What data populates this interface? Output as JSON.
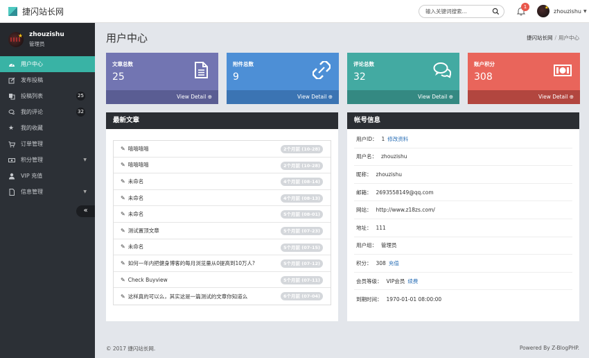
{
  "brand": {
    "name": "捷闪站长网"
  },
  "search": {
    "placeholder": "输入关键词搜索..."
  },
  "notifications": {
    "count": "1"
  },
  "user": {
    "name": "zhouzishu",
    "role": "管理员"
  },
  "sidebar": {
    "items": [
      {
        "label": "用户中心",
        "icon": "dashboard-icon",
        "active": true
      },
      {
        "label": "发布投稿",
        "icon": "edit-icon"
      },
      {
        "label": "投稿列表",
        "icon": "copy-icon",
        "badge": "25"
      },
      {
        "label": "我的评论",
        "icon": "comments-icon",
        "badge": "32"
      },
      {
        "label": "我的收藏",
        "icon": "star-icon"
      },
      {
        "label": "订单管理",
        "icon": "cart-icon"
      },
      {
        "label": "积分管理",
        "icon": "money-icon",
        "caret": true
      },
      {
        "label": "VIP 充值",
        "icon": "user-icon"
      },
      {
        "label": "信息管理",
        "icon": "file-icon",
        "caret": true
      }
    ],
    "collapse_label": "«"
  },
  "page": {
    "title": "用户中心",
    "breadcrumb": [
      "捷闪站长网",
      "/",
      "用户中心"
    ]
  },
  "stats": [
    {
      "label": "文章总数",
      "value": "25",
      "footer": "View Detail ⊕",
      "color": "#7275b2",
      "foot_color": "#5a5d93",
      "icon": "file-text-icon"
    },
    {
      "label": "附件总数",
      "value": "9",
      "footer": "View Detail ⊕",
      "color": "#4d8fd6",
      "foot_color": "#3b74b3",
      "icon": "broken-link-icon"
    },
    {
      "label": "评论总数",
      "value": "32",
      "footer": "View Detail ⊕",
      "color": "#43aaa2",
      "foot_color": "#348982",
      "icon": "comments-icon"
    },
    {
      "label": "账户积分",
      "value": "308",
      "footer": "View Detail ⊕",
      "color": "#e9655b",
      "foot_color": "#b2463f",
      "icon": "money-bill-icon"
    }
  ],
  "latest": {
    "title": "最新文章",
    "articles": [
      {
        "title": "嘻嘻嘻嘻",
        "date": "2个月前 (10-28)"
      },
      {
        "title": "嘻嘻嘻嘻",
        "date": "2个月前 (10-28)"
      },
      {
        "title": "未命名",
        "date": "4个月前 (08-14)"
      },
      {
        "title": "未命名",
        "date": "4个月前 (08-13)"
      },
      {
        "title": "未命名",
        "date": "5个月前 (08-01)"
      },
      {
        "title": "测试置顶文章",
        "date": "5个月前 (07-23)"
      },
      {
        "title": "未命名",
        "date": "5个月前 (07-15)"
      },
      {
        "title": "如何一年内把健身博客的每月浏览量从0提高到10万人?",
        "date": "5个月前 (07-12)"
      },
      {
        "title": "Check Buyview",
        "date": "5个月前 (07-11)"
      },
      {
        "title": "这样真的可以么，其实这是一篇测试的文章你知道么",
        "date": "6个月前 (07-04)"
      }
    ]
  },
  "account": {
    "title": "帐号信息",
    "rows": [
      {
        "key": "用户ID：",
        "value": "1",
        "link": "修改资料"
      },
      {
        "key": "用户名：",
        "value": "zhouzishu",
        "link": ""
      },
      {
        "key": "昵称：",
        "value": "zhouzishu",
        "link": ""
      },
      {
        "key": "邮箱：",
        "value": "2693558149@qq.com",
        "link": ""
      },
      {
        "key": "网站：",
        "value": "http://www.z18zs.com/",
        "link": ""
      },
      {
        "key": "地址：",
        "value": "111",
        "link": ""
      },
      {
        "key": "用户组：",
        "value": "管理员",
        "link": ""
      },
      {
        "key": "积分：",
        "value": "308",
        "link": "充值"
      },
      {
        "key": "会员等级：",
        "value": "VIP会员",
        "link": "续费"
      },
      {
        "key": "到期时间：",
        "value": "1970-01-01 08:00:00",
        "link": ""
      }
    ]
  },
  "footer": {
    "left": "© 2017 捷闪站长网.",
    "right": "Powered By Z-BlogPHP."
  }
}
